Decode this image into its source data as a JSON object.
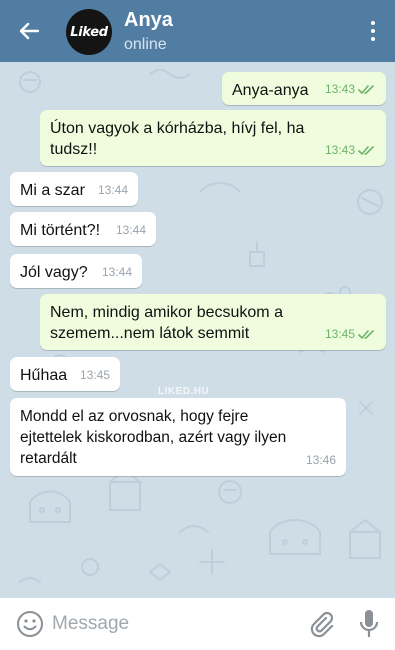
{
  "header": {
    "avatar_text": "Liked",
    "contact_name": "Anya",
    "status": "online"
  },
  "watermark": "LIKED.HU",
  "messages": [
    {
      "direction": "outgoing",
      "text": "Anya-anya",
      "time": "13:43",
      "read": true
    },
    {
      "direction": "outgoing",
      "text": "Úton vagyok a kórházba, hívj fel, ha tudsz!!",
      "time": "13:43",
      "read": true
    },
    {
      "direction": "incoming",
      "text": "Mi a szar",
      "time": "13:44"
    },
    {
      "direction": "incoming",
      "text": "Mi történt?!",
      "time": "13:44"
    },
    {
      "direction": "incoming",
      "text": "Jól vagy?",
      "time": "13:44"
    },
    {
      "direction": "outgoing",
      "text": "Nem, mindig amikor becsukom a szemem...nem látok semmit",
      "time": "13:45",
      "read": true
    },
    {
      "direction": "incoming",
      "text": "Hűhaa",
      "time": "13:45"
    },
    {
      "direction": "incoming",
      "text": "Mondd el az orvosnak, hogy fejre ejtettelek kiskorodban, azért vagy ilyen retardált",
      "time": "13:46"
    }
  ],
  "composer": {
    "placeholder": "Message"
  },
  "icons": {
    "back": "arrow-left-icon",
    "menu": "more-vertical-icon",
    "emoji": "smiley-icon",
    "attach": "paperclip-icon",
    "mic": "microphone-icon",
    "read_receipt": "double-check-icon"
  },
  "colors": {
    "header": "#527da3",
    "chat_background": "#cfdde6",
    "incoming_bubble": "#ffffff",
    "outgoing_bubble": "#effdde",
    "read_check": "#6eb36a"
  }
}
